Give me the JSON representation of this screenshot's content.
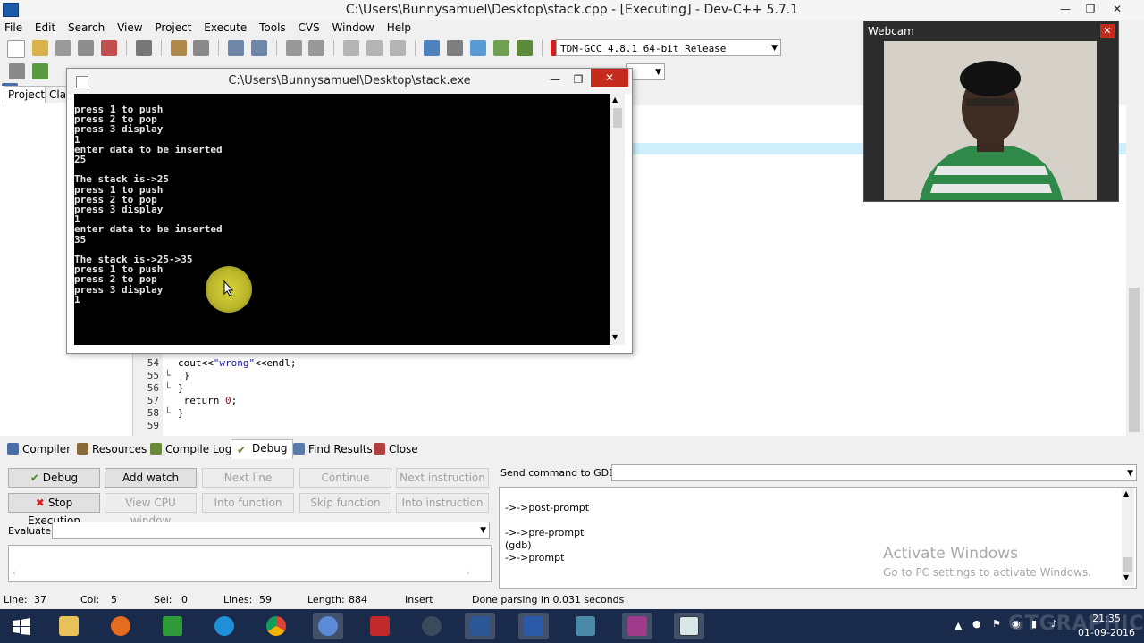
{
  "window": {
    "title": "C:\\Users\\Bunnysamuel\\Desktop\\stack.cpp - [Executing] - Dev-C++ 5.7.1",
    "min": "—",
    "max": "❐",
    "close": "✕"
  },
  "menu": [
    "File",
    "Edit",
    "Search",
    "View",
    "Project",
    "Execute",
    "Tools",
    "CVS",
    "Window",
    "Help"
  ],
  "compiler_select": {
    "value": "TDM-GCC 4.8.1 64-bit Release"
  },
  "left_panel": {
    "tabs": [
      "Project",
      "Clas"
    ]
  },
  "editor": {
    "lines": [
      {
        "no": "54",
        "fold": "",
        "pre": "cout<<",
        "str": "\"wrong\"",
        "post": "<<endl;",
        "num": ""
      },
      {
        "no": "55",
        "fold": "└",
        "pre": " }",
        "str": "",
        "post": "",
        "num": ""
      },
      {
        "no": "56",
        "fold": "└",
        "pre": "}",
        "str": "",
        "post": "",
        "num": ""
      },
      {
        "no": "57",
        "fold": "",
        "pre": " return ",
        "str": "",
        "post": ";",
        "num": "0"
      },
      {
        "no": "58",
        "fold": "└",
        "pre": "}",
        "str": "",
        "post": "",
        "num": ""
      },
      {
        "no": "59",
        "fold": "",
        "pre": "",
        "str": "",
        "post": "",
        "num": ""
      }
    ]
  },
  "console": {
    "title": "C:\\Users\\Bunnysamuel\\Desktop\\stack.exe",
    "output": "press 1 to push\npress 2 to pop\npress 3 display\n1\nenter data to be inserted\n25\n\nThe stack is->25\npress 1 to push\npress 2 to pop\npress 3 display\n1\nenter data to be inserted\n35\n\nThe stack is->25->35\npress 1 to push\npress 2 to pop\npress 3 display\n1"
  },
  "webcam": {
    "title": "Webcam",
    "close": "✕"
  },
  "bottom_tabs": [
    "Compiler",
    "Resources",
    "Compile Log",
    "Debug",
    "Find Results",
    "Close"
  ],
  "debug": {
    "buttons": {
      "debug": "Debug",
      "add_watch": "Add watch",
      "next_line": "Next line",
      "continue": "Continue",
      "next_instruction": "Next instruction",
      "stop_execution": "Stop Execution",
      "view_cpu": "View CPU window",
      "into_function": "Into function",
      "skip_function": "Skip function",
      "into_instruction": "Into instruction"
    },
    "evaluate_label": "Evaluate:",
    "gdb_label": "Send command to GDB:",
    "gdb_output": [
      "->->post-prompt",
      "",
      "->->pre-prompt",
      "(gdb)",
      "->->prompt"
    ]
  },
  "watermark": {
    "line1": "Activate Windows",
    "line2": "Go to PC settings to activate Windows."
  },
  "status": {
    "line_label": "Line:",
    "line": "37",
    "col_label": "Col:",
    "col": "5",
    "sel_label": "Sel:",
    "sel": "0",
    "lines_label": "Lines:",
    "lines": "59",
    "length_label": "Length:",
    "length": "884",
    "mode": "Insert",
    "message": "Done parsing in 0.031 seconds"
  },
  "taskbar": {
    "time": "21:35",
    "date": "01-09-2016",
    "overlay": "GTGRAPHICS.DE"
  },
  "colors": {
    "taskbar": "#1a2a4a",
    "console_bg": "#000000",
    "highlight": "#cfeffd"
  }
}
